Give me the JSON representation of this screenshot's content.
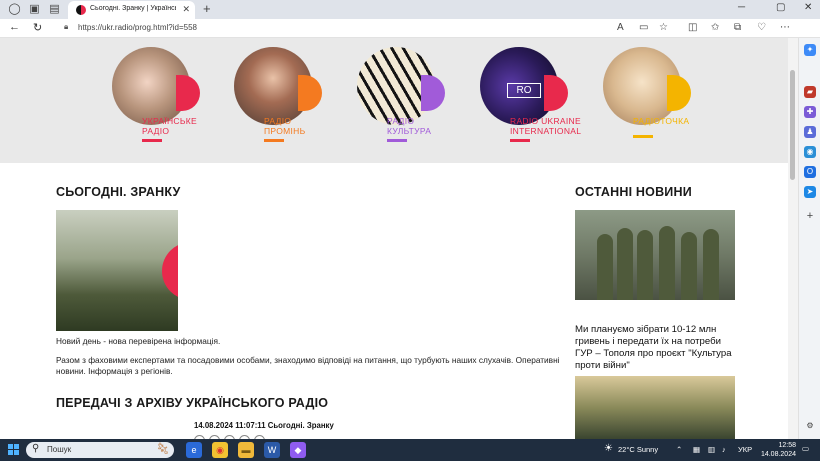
{
  "browser": {
    "tab_title": "Сьогодні. Зранку | Український р",
    "url": "https://ukr.radio/prog.html?id=558",
    "new_tab_symbol": "+",
    "tab_close_symbol": "✕"
  },
  "stations": [
    {
      "label": "УКРАЇНСЬКЕ\nРАДІО",
      "color": "#e8294c"
    },
    {
      "label": "РАДІО\nПРОМІНЬ",
      "color": "#f47a20"
    },
    {
      "label": "РАДІО\nКУЛЬТУРА",
      "color": "#a15bd9"
    },
    {
      "label": "RADIO UKRAINE\nINTERNATIONAL",
      "color": "#e8294c",
      "badge": "RO"
    },
    {
      "label": "РАДІОТОЧКА",
      "color": "#f4b400"
    }
  ],
  "main": {
    "title": "СЬОГОДНІ. ЗРАНКУ",
    "description": "Новий день - нова перевірена інформація.",
    "paragraph": "Разом з фаховими експертами та посадовими особами, знаходимо відповіді на питання, що турбують наших слухачів. Оперативні новини. Інформація з регіонів.",
    "archive_title": "ПЕРЕДАЧІ З АРХІВУ УКРАЇНСЬКОГО РАДІО",
    "archive_item": "14.08.2024 11:07:11 Сьогодні. Зранку"
  },
  "news": {
    "title": "ОСТАННІ НОВИНИ",
    "items": [
      {
        "text": "Ми плануємо зібрати 10-12 млн гривень і передати їх на потреби ГУР – Тополя про проєкт \"Культура проти війни\""
      }
    ]
  },
  "taskbar": {
    "search_placeholder": "Пошук",
    "weather": "22°C  Sunny",
    "language": "УКР",
    "time": "12:58",
    "date": "14.08.2024"
  }
}
